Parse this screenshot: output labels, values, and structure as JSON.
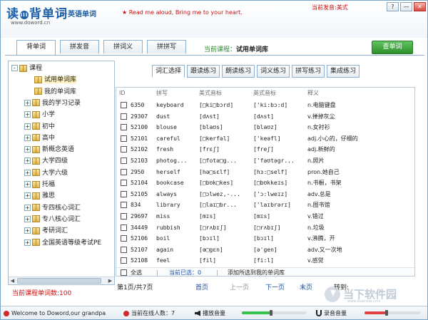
{
  "app": {
    "logo_main_a": "读",
    "logo_badge": "iii",
    "logo_main_b": "背单词",
    "logo_sub": "－英语单词",
    "logo_url": "www.doword.cn",
    "slogan": "Read me aloud, Bring me to your heart.",
    "current_voice_label": "当前发音:",
    "current_voice_value": "美式",
    "win_buttons": [
      "?",
      "—",
      "✕"
    ]
  },
  "main_tabs": [
    {
      "label": "背单词",
      "active": true
    },
    {
      "label": "拼发音",
      "active": false
    },
    {
      "label": "拼词义",
      "active": false
    },
    {
      "label": "拼拼写",
      "active": false
    }
  ],
  "course": {
    "label": "当前课程：",
    "value": "试用单词库"
  },
  "lookup_button": "查单词",
  "sidebar": {
    "items": [
      {
        "label": "课程",
        "level": 0,
        "expander": "-",
        "selected": false
      },
      {
        "label": "试用单词库",
        "level": 2,
        "expander": "",
        "selected": true
      },
      {
        "label": "我的单词库",
        "level": 2,
        "expander": "",
        "selected": false
      },
      {
        "label": "我的学习记录",
        "level": 1,
        "expander": "+",
        "selected": false
      },
      {
        "label": "小学",
        "level": 1,
        "expander": "+",
        "selected": false
      },
      {
        "label": "初中",
        "level": 1,
        "expander": "+",
        "selected": false
      },
      {
        "label": "高中",
        "level": 1,
        "expander": "+",
        "selected": false
      },
      {
        "label": "新概念英语",
        "level": 1,
        "expander": "+",
        "selected": false
      },
      {
        "label": "大学四级",
        "level": 1,
        "expander": "+",
        "selected": false
      },
      {
        "label": "大学六级",
        "level": 1,
        "expander": "+",
        "selected": false
      },
      {
        "label": "托福",
        "level": 1,
        "expander": "+",
        "selected": false
      },
      {
        "label": "雅思",
        "level": 1,
        "expander": "+",
        "selected": false
      },
      {
        "label": "专四核心词汇",
        "level": 1,
        "expander": "+",
        "selected": false
      },
      {
        "label": "专八核心词汇",
        "level": 1,
        "expander": "+",
        "selected": false
      },
      {
        "label": "考研词汇",
        "level": 1,
        "expander": "+",
        "selected": false
      },
      {
        "label": "全国英语等级考试PE",
        "level": 1,
        "expander": "+",
        "selected": false
      }
    ]
  },
  "word_count_label": "当前课程单词数:100",
  "sub_tabs": [
    {
      "label": "词汇选择",
      "active": true
    },
    {
      "label": "跟读练习",
      "active": false
    },
    {
      "label": "朗读练习",
      "active": false
    },
    {
      "label": "词义练习",
      "active": false
    },
    {
      "label": "拼写练习",
      "active": false
    },
    {
      "label": "集成练习",
      "active": false
    }
  ],
  "table": {
    "headers": [
      "ID",
      "拼写",
      "美式音标",
      "英式音标",
      "释义"
    ],
    "rows": [
      {
        "id": "6350",
        "spell": "keyboard",
        "us": "[□ki□bɔrd]",
        "uk": "['ki:bɔ:d]",
        "def": "n.电脑键盘"
      },
      {
        "id": "29307",
        "spell": "dust",
        "us": "[dʌst]",
        "uk": "[dʌst]",
        "def": "v.掸掉灰尘"
      },
      {
        "id": "52100",
        "spell": "blouse",
        "us": "[blaʊs]",
        "uk": "[blaʊz]",
        "def": "n.女衬衫"
      },
      {
        "id": "52101",
        "spell": "careful",
        "us": "[□kerfəl]",
        "uk": "['keəfl]",
        "def": "adj.小心的，仔细的"
      },
      {
        "id": "52102",
        "spell": "fresh",
        "us": "[frεʃ]",
        "uk": "[freʃ]",
        "def": "adj.新鲜的"
      },
      {
        "id": "52103",
        "spell": "photog...",
        "us": "[□fotə□g...",
        "uk": "['fəʊtəgr...",
        "def": "n.照片"
      },
      {
        "id": "2950",
        "spell": "herself",
        "us": "[hə□sεlf]",
        "uk": "[hɜ:□self]",
        "def": "pron.她自己"
      },
      {
        "id": "52104",
        "spell": "bookcase",
        "us": "[□bʊk□kes]",
        "uk": "[□bʊkkeɪs]",
        "def": "n.书橱，书架"
      },
      {
        "id": "52105",
        "spell": "always",
        "us": "[□ɔlwez,-...",
        "uk": "['ɔ:lweɪz]",
        "def": "adv.总是"
      },
      {
        "id": "834",
        "spell": "library",
        "us": "[□laɪ□br...",
        "uk": "['laɪbrərɪ]",
        "def": "n.图书馆"
      },
      {
        "id": "29697",
        "spell": "miss",
        "us": "[mɪs]",
        "uk": "[mɪs]",
        "def": "v.错过"
      },
      {
        "id": "34449",
        "spell": "rubbish",
        "us": "[□rʌbɪʃ]",
        "uk": "[□rʌbɪʃ]",
        "def": "n.垃圾"
      },
      {
        "id": "52106",
        "spell": "boil",
        "us": "[bɔɪl]",
        "uk": "[bɔɪl]",
        "def": "v.沸腾，开"
      },
      {
        "id": "52107",
        "spell": "again",
        "us": "[ə□gεn]",
        "uk": "[ə'gen]",
        "def": "adv.又一次地"
      },
      {
        "id": "52108",
        "spell": "feel",
        "us": "[fil]",
        "uk": "[fi:l]",
        "def": "v.感觉"
      }
    ],
    "footer": {
      "select_all": "全选",
      "separator": "|",
      "selected_label": "当前已选：0",
      "add_label": "添加所选到我的单词库"
    }
  },
  "pager": {
    "page_info": "第1页/共7页",
    "first": "首页",
    "prev": "上一页",
    "next": "下一页",
    "last": "末页",
    "goto": "转到:"
  },
  "status": {
    "welcome": "Welcome to Doword,our grandpa",
    "online": "当前在线人数：7",
    "play_volume": "播放音量",
    "record_volume": "录音音量",
    "play_level": 0.45,
    "record_level": 0.4
  },
  "watermark": {
    "text": "当下软件园",
    "sub": "www.downxia.com"
  }
}
